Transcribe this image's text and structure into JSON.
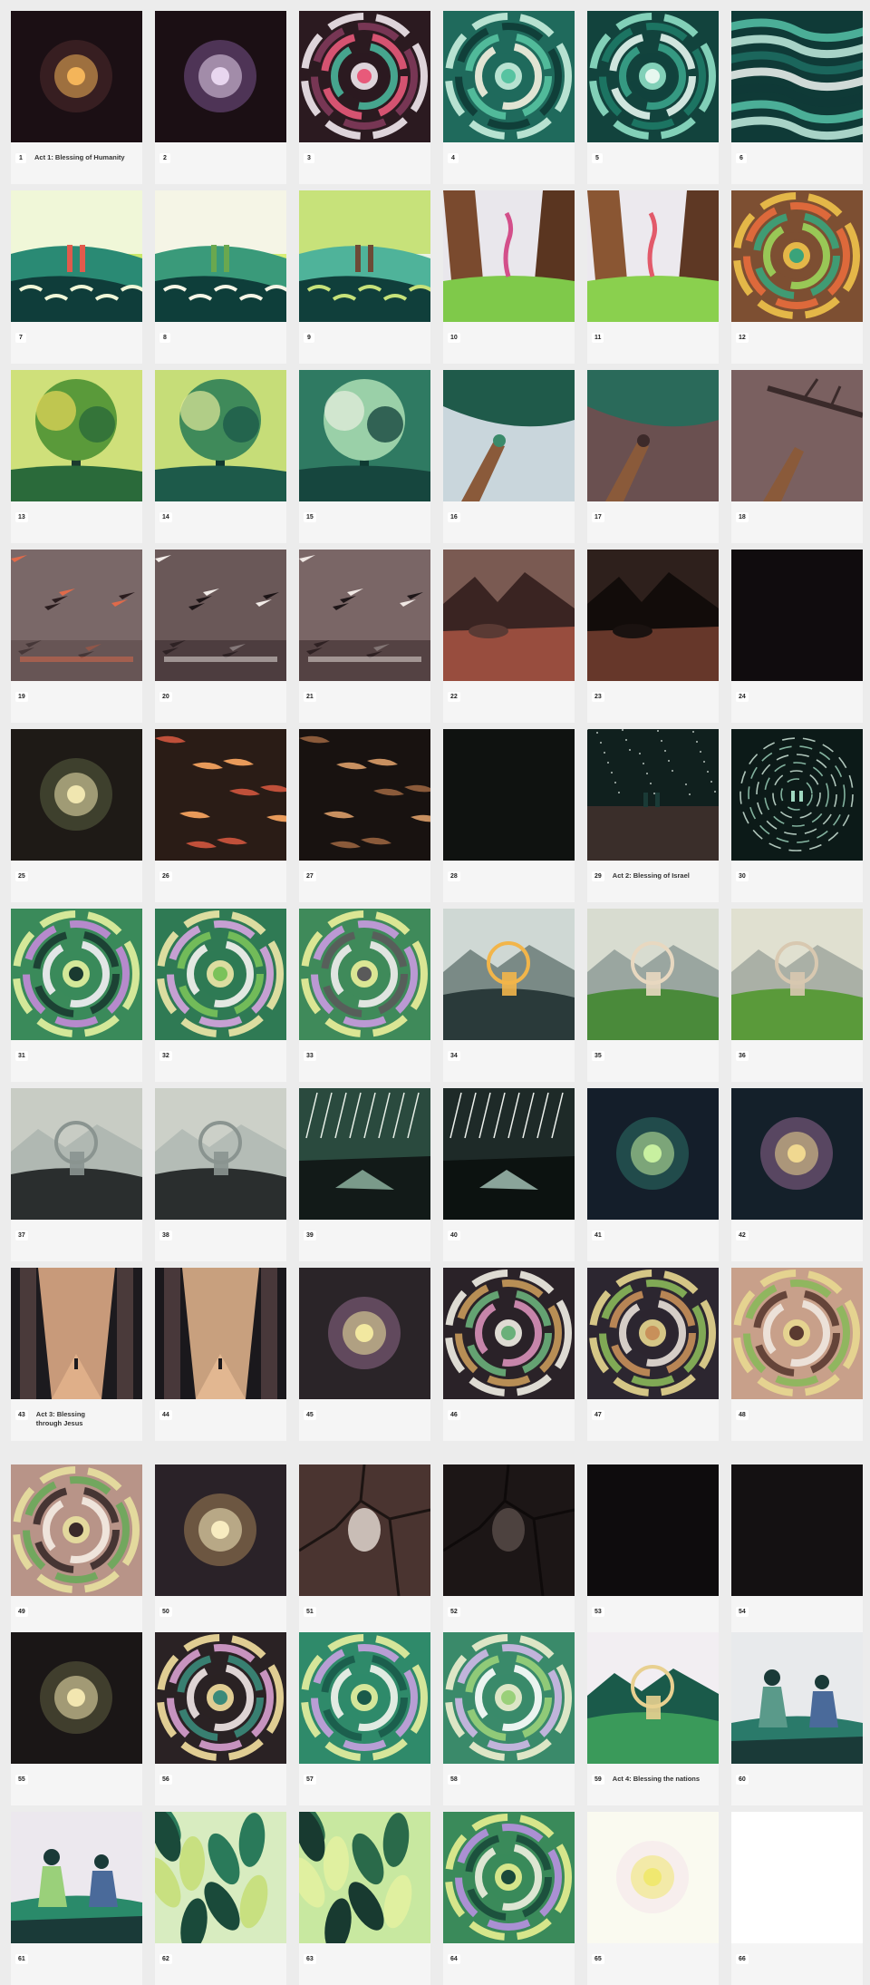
{
  "frames": [
    {
      "n": "1",
      "label": "Act 1: Blessing of Humanity",
      "style": "glow",
      "c": [
        "#1b0f14",
        "#f4b55a",
        "#6e3c3a"
      ]
    },
    {
      "n": "2",
      "label": "",
      "style": "glow",
      "c": [
        "#1b0f14",
        "#e8d6ef",
        "#b07bd0"
      ]
    },
    {
      "n": "3",
      "label": "",
      "style": "swirl",
      "c": [
        "#2b1a20",
        "#f2e9ee",
        "#7f3a5a",
        "#e85a7a",
        "#49b59a"
      ]
    },
    {
      "n": "4",
      "label": "",
      "style": "swirl",
      "c": [
        "#1f6a5c",
        "#c8f0de",
        "#0e3b35",
        "#57c3a1",
        "#f6f2e0"
      ]
    },
    {
      "n": "5",
      "label": "",
      "style": "swirl",
      "c": [
        "#12433d",
        "#8fe0c5",
        "#1e7a66",
        "#e6f7ef",
        "#3aa38a"
      ]
    },
    {
      "n": "6",
      "label": "",
      "style": "waves",
      "c": [
        "#0f3a37",
        "#56c3a8",
        "#c3eee0",
        "#1d6e63",
        "#f2f7f3"
      ]
    },
    {
      "n": "7",
      "label": "",
      "style": "scene",
      "c": [
        "#c9e86a",
        "#2a8a74",
        "#0f3d3a",
        "#f0f7d8",
        "#e25a4c"
      ]
    },
    {
      "n": "8",
      "label": "",
      "style": "scene",
      "c": [
        "#d8ef78",
        "#3a9a7a",
        "#0e3e3a",
        "#f5f5e6",
        "#6aa84f"
      ]
    },
    {
      "n": "9",
      "label": "",
      "style": "scene",
      "c": [
        "#eaf2e4",
        "#4fb39a",
        "#103f3b",
        "#c7e27a",
        "#6d4a36"
      ]
    },
    {
      "n": "10",
      "label": "",
      "style": "trees",
      "c": [
        "#e9e7ec",
        "#7a4a2e",
        "#5a3520",
        "#7fc94a",
        "#d34f8a"
      ]
    },
    {
      "n": "11",
      "label": "",
      "style": "trees",
      "c": [
        "#ece9ee",
        "#8a5633",
        "#5e3824",
        "#8ad04e",
        "#e25a6a"
      ]
    },
    {
      "n": "12",
      "label": "",
      "style": "swirl",
      "c": [
        "#7d4f32",
        "#f0c24a",
        "#e86b3c",
        "#3aa37a",
        "#9cd45a"
      ]
    },
    {
      "n": "13",
      "label": "",
      "style": "tree",
      "c": [
        "#cfe07a",
        "#5a9a3a",
        "#2a6a3a",
        "#e9d85a",
        "#1c3a2e"
      ]
    },
    {
      "n": "14",
      "label": "",
      "style": "tree",
      "c": [
        "#c6dd78",
        "#3f8a5a",
        "#1d5a4a",
        "#e2ea9a",
        "#123a30"
      ]
    },
    {
      "n": "15",
      "label": "",
      "style": "tree",
      "c": [
        "#2f7a62",
        "#9ad0a8",
        "#16463e",
        "#e8f0e0",
        "#0f3a32"
      ]
    },
    {
      "n": "16",
      "label": "",
      "style": "hand",
      "c": [
        "#c9d6dc",
        "#1f5a4a",
        "#8a5a3a",
        "#e6eef0",
        "#3a8a6a"
      ]
    },
    {
      "n": "17",
      "label": "",
      "style": "hand",
      "c": [
        "#6a5050",
        "#2a6a5a",
        "#8a5a3a",
        "#b9c9c6",
        "#3d2a2a"
      ]
    },
    {
      "n": "18",
      "label": "",
      "style": "branch",
      "c": [
        "#7a6060",
        "#3a2a2a",
        "#8a5a3a",
        "#6a5050",
        "#2a1a1a"
      ]
    },
    {
      "n": "19",
      "label": "",
      "style": "shards",
      "c": [
        "#7a6868",
        "#2a1c1e",
        "#e06a4a",
        "#9a8484",
        "#5a4a4a"
      ]
    },
    {
      "n": "20",
      "label": "",
      "style": "shards",
      "c": [
        "#6a5858",
        "#1c1416",
        "#f2ece8",
        "#8a7676",
        "#3a2c2e"
      ]
    },
    {
      "n": "21",
      "label": "",
      "style": "shards",
      "c": [
        "#7a6666",
        "#1e1618",
        "#f0e8e4",
        "#a08a88",
        "#3a2a2c"
      ]
    },
    {
      "n": "22",
      "label": "",
      "style": "land",
      "c": [
        "#7a5a52",
        "#3a2422",
        "#c0604a",
        "#e8c8b8",
        "#5a3a34"
      ]
    },
    {
      "n": "23",
      "label": "",
      "style": "land",
      "c": [
        "#2e201c",
        "#120c0a",
        "#8a4a38",
        "#5a3a30",
        "#1a1210"
      ]
    },
    {
      "n": "24",
      "label": "",
      "style": "dark",
      "c": [
        "#0e0b0c",
        "#141012",
        "#0e0b0c",
        "#0e0b0c",
        "#0e0b0c"
      ]
    },
    {
      "n": "25",
      "label": "",
      "style": "glow",
      "c": [
        "#1e1a16",
        "#f0e6b0",
        "#7a8a5a"
      ]
    },
    {
      "n": "26",
      "label": "",
      "style": "embers",
      "c": [
        "#2a1c16",
        "#e89a5a",
        "#6a3a2a",
        "#c0503a",
        "#120c0a"
      ]
    },
    {
      "n": "27",
      "label": "",
      "style": "embers",
      "c": [
        "#181210",
        "#c89060",
        "#5a3a2a",
        "#8a5a3a",
        "#0c0808"
      ]
    },
    {
      "n": "28",
      "label": "",
      "style": "dark",
      "c": [
        "#0d0f0e",
        "#131614",
        "#0d0f0e",
        "#0d0f0e",
        "#0d0f0e"
      ]
    },
    {
      "n": "29",
      "label": "Act 2: Blessing of Israel",
      "style": "night",
      "c": [
        "#10201e",
        "#e6efe8",
        "#3a2e2a",
        "#1a3a36",
        "#f5f5f5"
      ]
    },
    {
      "n": "30",
      "label": "",
      "style": "rings",
      "c": [
        "#0c1a18",
        "#d8f0e4",
        "#3a7a6a",
        "#0c1a18",
        "#a0d8c0"
      ]
    },
    {
      "n": "31",
      "label": "",
      "style": "swirl",
      "c": [
        "#3a8a5a",
        "#e6f2a0",
        "#c48ad8",
        "#1a3a30",
        "#f5f0f5"
      ]
    },
    {
      "n": "32",
      "label": "",
      "style": "swirl",
      "c": [
        "#2f7a54",
        "#f0e8a8",
        "#d7a4e0",
        "#7ac25a",
        "#f7f4f2"
      ]
    },
    {
      "n": "33",
      "label": "",
      "style": "swirl",
      "c": [
        "#3f8a5a",
        "#ecef9a",
        "#c99ae0",
        "#5a5a5a",
        "#f2eeee"
      ]
    },
    {
      "n": "34",
      "label": "",
      "style": "vista",
      "c": [
        "#cfd8d4",
        "#2a3a3a",
        "#f2b54a",
        "#7a8a86",
        "#e8ecea"
      ]
    },
    {
      "n": "35",
      "label": "",
      "style": "vista",
      "c": [
        "#d8dcd0",
        "#4a8a3a",
        "#e8d8c0",
        "#9aa6a0",
        "#b8d89a"
      ]
    },
    {
      "n": "36",
      "label": "",
      "style": "vista",
      "c": [
        "#e0e0d0",
        "#5a9a3a",
        "#d8c8b0",
        "#aab0a6",
        "#c8e08a"
      ]
    },
    {
      "n": "37",
      "label": "",
      "style": "vista",
      "c": [
        "#c8ccc4",
        "#2a2e2e",
        "#8a9490",
        "#b0b8b2",
        "#4a5250"
      ]
    },
    {
      "n": "38",
      "label": "",
      "style": "vista",
      "c": [
        "#ccd0c8",
        "#2a2e2e",
        "#8a9490",
        "#b4bcb6",
        "#4a5250"
      ]
    },
    {
      "n": "39",
      "label": "",
      "style": "rain",
      "c": [
        "#2a4a3e",
        "#e8f0e8",
        "#7a9a8a",
        "#121a18",
        "#a8c0b0"
      ]
    },
    {
      "n": "40",
      "label": "",
      "style": "rain",
      "c": [
        "#1e2a28",
        "#eef2ee",
        "#8aa49a",
        "#0c1210",
        "#b8c8c0"
      ]
    },
    {
      "n": "41",
      "label": "",
      "style": "glow",
      "c": [
        "#141e2a",
        "#c8f0a0",
        "#3aa08a"
      ]
    },
    {
      "n": "42",
      "label": "",
      "style": "glow",
      "c": [
        "#14202a",
        "#f0d890",
        "#d890c8"
      ]
    },
    {
      "n": "43",
      "label": "Act 3: Blessing through Jesus",
      "style": "pillars",
      "c": [
        "#c89a7a",
        "#1c1a1e",
        "#e8b890",
        "#4a3a3a",
        "#7a5a4a"
      ]
    },
    {
      "n": "44",
      "label": "",
      "style": "pillars",
      "c": [
        "#c8a07e",
        "#1a181c",
        "#ecc09a",
        "#48383a",
        "#785848"
      ]
    },
    {
      "n": "45",
      "label": "",
      "style": "glow",
      "c": [
        "#2a2428",
        "#f2e8a0",
        "#c890c0"
      ]
    },
    {
      "n": "46",
      "label": "",
      "style": "swirl",
      "c": [
        "#2a2228",
        "#f2efe6",
        "#c89a5a",
        "#6ab07a",
        "#d890b8"
      ]
    },
    {
      "n": "47",
      "label": "",
      "style": "swirl",
      "c": [
        "#2c2630",
        "#e8d890",
        "#8ab85a",
        "#c8905a",
        "#e8e0d8"
      ]
    },
    {
      "n": "48",
      "label": "",
      "style": "swirl",
      "c": [
        "#c8a08a",
        "#e8d890",
        "#8ab85a",
        "#5a3a30",
        "#f0e8e0"
      ]
    },
    {
      "n": "49",
      "label": "",
      "style": "swirl",
      "c": [
        "#b89488",
        "#e8e0a0",
        "#6aa85a",
        "#3a2a2a",
        "#f5ece4"
      ]
    },
    {
      "n": "50",
      "label": "",
      "style": "glow",
      "c": [
        "#2a2228",
        "#f8ecc0",
        "#e8b870"
      ]
    },
    {
      "n": "51",
      "label": "",
      "style": "cracks",
      "c": [
        "#4a3430",
        "#1c1412",
        "#e8e0d8",
        "#2a1c1a",
        "#6a4a44"
      ]
    },
    {
      "n": "52",
      "label": "",
      "style": "cracks",
      "c": [
        "#1c1616",
        "#0e0a0a",
        "#5a4e4a",
        "#141010",
        "#2a2220"
      ]
    },
    {
      "n": "53",
      "label": "",
      "style": "dark",
      "c": [
        "#0d0b0c",
        "#110e0f",
        "#0d0b0c",
        "#0d0b0c",
        "#0d0b0c"
      ]
    },
    {
      "n": "54",
      "label": "",
      "style": "dark",
      "c": [
        "#0f0d0e",
        "#1c1818",
        "#0f0d0e",
        "#0f0d0e",
        "#0f0d0e"
      ]
    },
    {
      "n": "55",
      "label": "",
      "style": "glow",
      "c": [
        "#1a1616",
        "#f2e6b0",
        "#8a8a5a"
      ]
    },
    {
      "n": "56",
      "label": "",
      "style": "swirl",
      "c": [
        "#2a2224",
        "#f4e0a0",
        "#d8a0d0",
        "#3a8a7a",
        "#f2e8e8"
      ]
    },
    {
      "n": "57",
      "label": "",
      "style": "swirl",
      "c": [
        "#2f8a6a",
        "#e8f0a0",
        "#c8a0e0",
        "#1a5a4a",
        "#f5f5f0"
      ]
    },
    {
      "n": "58",
      "label": "",
      "style": "swirl",
      "c": [
        "#3a8a6a",
        "#f0f0d0",
        "#d0b8e8",
        "#9ad07a",
        "#ffffff"
      ]
    },
    {
      "n": "59",
      "label": "Act 4: Blessing the nations",
      "style": "vista",
      "c": [
        "#f2eef2",
        "#3a9a5a",
        "#e8d090",
        "#1a5a4a",
        "#ffffff"
      ]
    },
    {
      "n": "60",
      "label": "",
      "style": "people",
      "c": [
        "#e8eaec",
        "#2a7a6a",
        "#1a3a38",
        "#5a9a8a",
        "#4a6a9a"
      ]
    },
    {
      "n": "61",
      "label": "",
      "style": "people",
      "c": [
        "#ece8ee",
        "#2a8a6a",
        "#1a3a38",
        "#9ad07a",
        "#4a6a9a"
      ]
    },
    {
      "n": "62",
      "label": "",
      "style": "leaves",
      "c": [
        "#d8ecc0",
        "#2a7a5a",
        "#c8e080",
        "#ffffff",
        "#1a4a3a"
      ]
    },
    {
      "n": "63",
      "label": "",
      "style": "leaves",
      "c": [
        "#c8e8a0",
        "#2a6a4a",
        "#e0f0a0",
        "#4a9a5a",
        "#183a30"
      ]
    },
    {
      "n": "64",
      "label": "",
      "style": "swirl",
      "c": [
        "#3a8a5a",
        "#e8f090",
        "#b890e0",
        "#1a4a3a",
        "#f0f0e0"
      ]
    },
    {
      "n": "65",
      "label": "",
      "style": "glow",
      "c": [
        "#fafaf0",
        "#f0e870",
        "#f0d8e8"
      ]
    },
    {
      "n": "66",
      "label": "",
      "style": "blank",
      "c": [
        "#ffffff",
        "#ffffff",
        "#ffffff",
        "#ffffff",
        "#ffffff"
      ]
    }
  ]
}
